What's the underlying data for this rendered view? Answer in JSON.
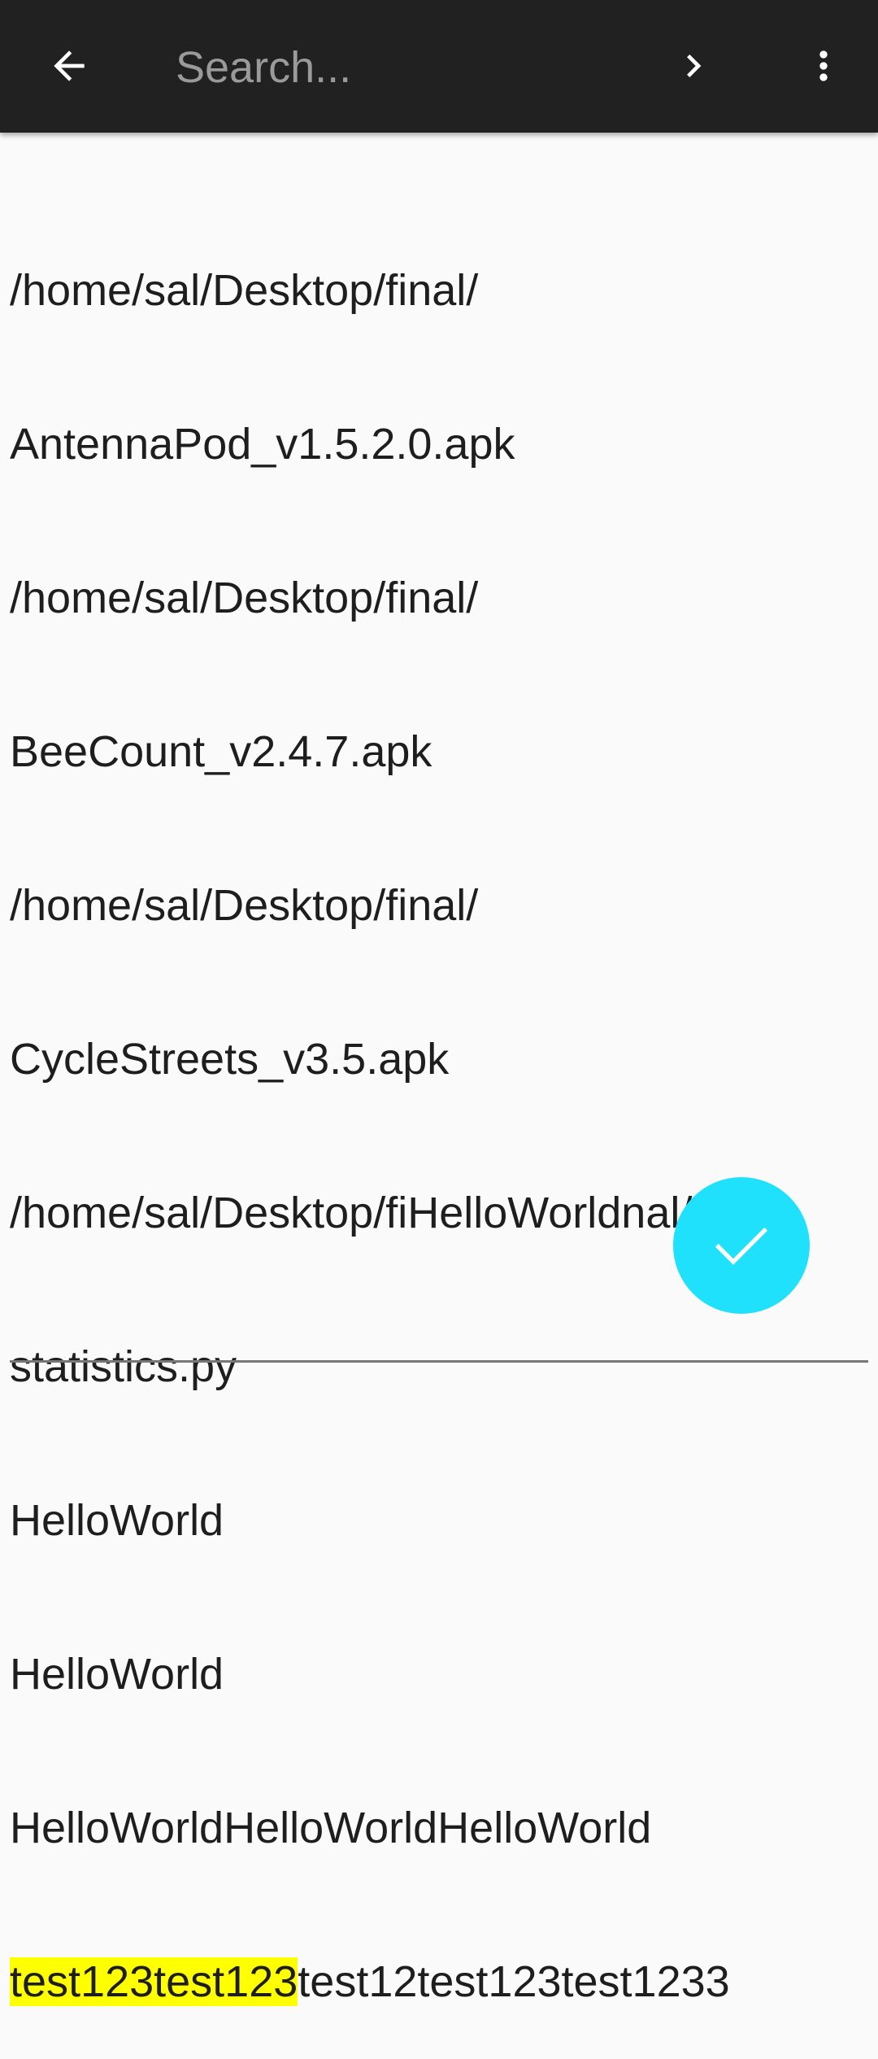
{
  "search": {
    "placeholder": "Search..."
  },
  "editor": {
    "lines": [
      "/home/sal/Desktop/final/",
      "AntennaPod_v1.5.2.0.apk",
      "/home/sal/Desktop/final/",
      "BeeCount_v2.4.7.apk",
      "/home/sal/Desktop/final/",
      "CycleStreets_v3.5.apk",
      "/home/sal/Desktop/fiHelloWorldnal/",
      "statistics.py",
      "HelloWorld",
      "HelloWorld",
      "HelloWorldHelloWorldHelloWorld"
    ],
    "last_line": {
      "highlighted": "test123test123",
      "rest": "test12test123test1233"
    }
  },
  "colors": {
    "toolbar": "#212121",
    "fab": "#20e1fb",
    "highlight": "#ffff00"
  },
  "icons": {
    "back": "arrow-left",
    "next": "chevron-right",
    "menu": "more-vertical",
    "fab": "check"
  }
}
